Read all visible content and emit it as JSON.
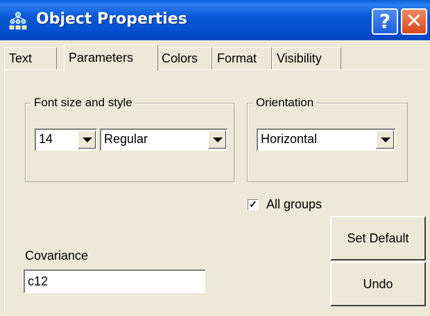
{
  "window": {
    "title": "Object Properties",
    "help_button": "?",
    "close_button": "✕",
    "title_color": "#0a58d6"
  },
  "tabs": [
    {
      "label": "Text",
      "active": false
    },
    {
      "label": "Parameters",
      "active": true
    },
    {
      "label": "Colors",
      "active": false
    },
    {
      "label": "Format",
      "active": false
    },
    {
      "label": "Visibility",
      "active": false
    }
  ],
  "font_group": {
    "legend": "Font size and style",
    "size_value": "14",
    "style_value": "Regular"
  },
  "orientation_group": {
    "legend": "Orientation",
    "value": "Horizontal"
  },
  "all_groups": {
    "label": "All groups",
    "checked": true,
    "check_mark": "✓"
  },
  "buttons": {
    "set_default": "Set Default",
    "undo": "Undo"
  },
  "covariance": {
    "label": "Covariance",
    "value": "c12"
  }
}
